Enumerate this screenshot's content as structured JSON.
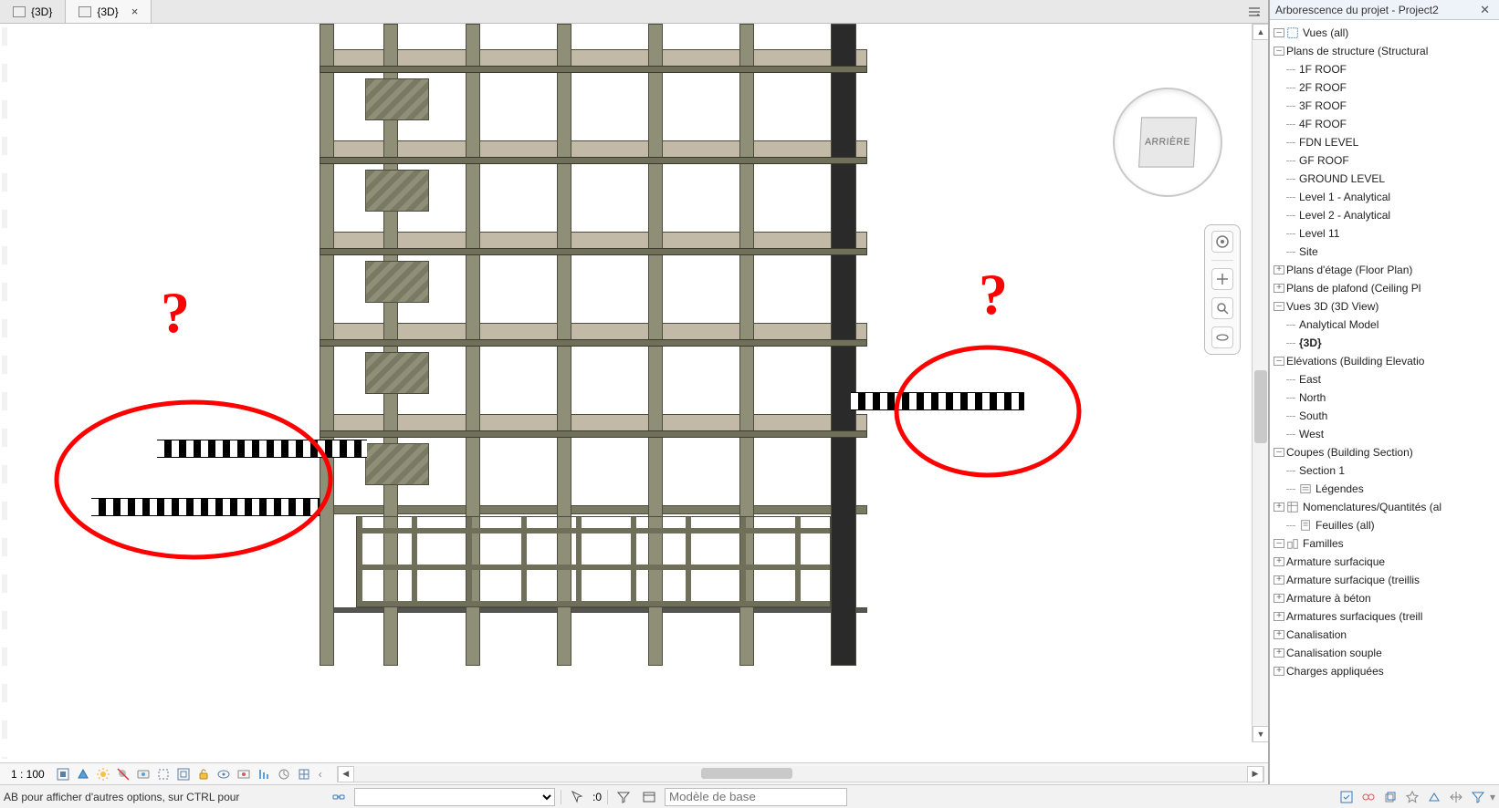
{
  "tabs": [
    {
      "label": "{3D}",
      "active": false
    },
    {
      "label": "{3D}",
      "active": true
    }
  ],
  "viewcube": {
    "face": "ARRIÈRE"
  },
  "scale": "1 : 100",
  "statusbar": {
    "hint": "AB pour afficher d'autres options, sur CTRL pour",
    "selection_count": ":0",
    "worksetPlaceholder": "Modèle de base"
  },
  "browser": {
    "title": "Arborescence du projet - Project2",
    "tree": [
      {
        "lvl": 0,
        "tw": "-",
        "label": "Vues (all)",
        "icon": "views"
      },
      {
        "lvl": 1,
        "tw": "-",
        "label": "Plans de structure (Structural"
      },
      {
        "lvl": 2,
        "tw": "",
        "label": "1F ROOF"
      },
      {
        "lvl": 2,
        "tw": "",
        "label": "2F ROOF"
      },
      {
        "lvl": 2,
        "tw": "",
        "label": "3F ROOF"
      },
      {
        "lvl": 2,
        "tw": "",
        "label": "4F ROOF"
      },
      {
        "lvl": 2,
        "tw": "",
        "label": "FDN LEVEL"
      },
      {
        "lvl": 2,
        "tw": "",
        "label": "GF ROOF"
      },
      {
        "lvl": 2,
        "tw": "",
        "label": "GROUND LEVEL"
      },
      {
        "lvl": 2,
        "tw": "",
        "label": "Level 1 - Analytical"
      },
      {
        "lvl": 2,
        "tw": "",
        "label": "Level 2 - Analytical"
      },
      {
        "lvl": 2,
        "tw": "",
        "label": "Level 11"
      },
      {
        "lvl": 2,
        "tw": "",
        "label": "Site"
      },
      {
        "lvl": 1,
        "tw": "+",
        "label": "Plans d'étage (Floor Plan)"
      },
      {
        "lvl": 1,
        "tw": "+",
        "label": "Plans de plafond (Ceiling Pl"
      },
      {
        "lvl": 1,
        "tw": "-",
        "label": "Vues 3D (3D View)"
      },
      {
        "lvl": 2,
        "tw": "",
        "label": "Analytical Model"
      },
      {
        "lvl": 2,
        "tw": "",
        "label": "{3D}",
        "active": true
      },
      {
        "lvl": 1,
        "tw": "-",
        "label": "Elévations (Building Elevatio"
      },
      {
        "lvl": 2,
        "tw": "",
        "label": "East"
      },
      {
        "lvl": 2,
        "tw": "",
        "label": "North"
      },
      {
        "lvl": 2,
        "tw": "",
        "label": "South"
      },
      {
        "lvl": 2,
        "tw": "",
        "label": "West"
      },
      {
        "lvl": 1,
        "tw": "-",
        "label": "Coupes (Building Section)"
      },
      {
        "lvl": 2,
        "tw": "",
        "label": "Section 1"
      },
      {
        "lvl": 0,
        "tw": "",
        "label": "Légendes",
        "icon": "legend"
      },
      {
        "lvl": 0,
        "tw": "+",
        "label": "Nomenclatures/Quantités (al",
        "icon": "schedule"
      },
      {
        "lvl": 0,
        "tw": "",
        "label": "Feuilles (all)",
        "icon": "sheet"
      },
      {
        "lvl": 0,
        "tw": "-",
        "label": "Familles",
        "icon": "families"
      },
      {
        "lvl": 1,
        "tw": "+",
        "label": "Armature surfacique"
      },
      {
        "lvl": 1,
        "tw": "+",
        "label": "Armature surfacique (treillis"
      },
      {
        "lvl": 1,
        "tw": "+",
        "label": "Armature à béton"
      },
      {
        "lvl": 1,
        "tw": "+",
        "label": "Armatures surfaciques (treill"
      },
      {
        "lvl": 1,
        "tw": "+",
        "label": "Canalisation"
      },
      {
        "lvl": 1,
        "tw": "+",
        "label": "Canalisation souple"
      },
      {
        "lvl": 1,
        "tw": "+",
        "label": "Charges appliquées"
      }
    ]
  }
}
